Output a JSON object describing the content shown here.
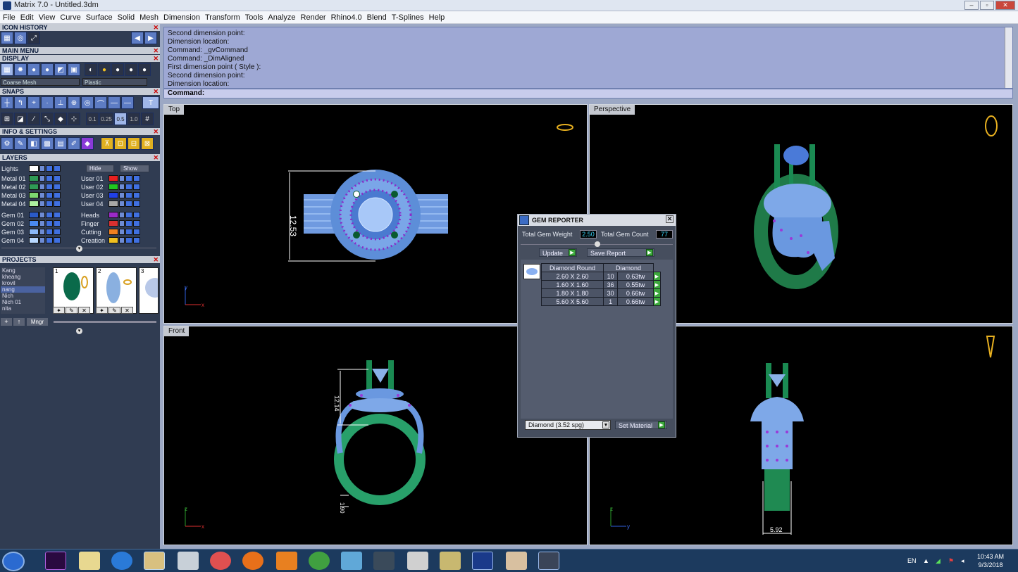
{
  "window": {
    "title": "Matrix 7.0 - Untitled.3dm",
    "min": "–",
    "max": "▫",
    "close": "✕"
  },
  "menu": [
    "File",
    "Edit",
    "View",
    "Curve",
    "Surface",
    "Solid",
    "Mesh",
    "Dimension",
    "Transform",
    "Tools",
    "Analyze",
    "Render",
    "Rhino4.0",
    "Blend",
    "T-Splines",
    "Help"
  ],
  "panel": {
    "icon_history": "ICON HISTORY",
    "main_menu": "MAIN MENU",
    "display": "DISPLAY",
    "display_dd1": "Coarse Mesh",
    "display_dd2": "Plastic",
    "snaps": "SNAPS",
    "snap_values": [
      "0.1",
      "0.25",
      "0.5",
      "1.0"
    ],
    "info": "INFO & SETTINGS",
    "layers": "LAYERS",
    "lights": "Lights",
    "hide": "Hide",
    "show": "Show",
    "layers_left": [
      {
        "name": "Metal 01",
        "color": "#2f9a55"
      },
      {
        "name": "Metal 02",
        "color": "#2f9a55"
      },
      {
        "name": "Metal 03",
        "color": "#7dd870"
      },
      {
        "name": "Metal 04",
        "color": "#aef0a0"
      },
      {
        "name": "Gem 01",
        "color": "#2a5ac8"
      },
      {
        "name": "Gem 02",
        "color": "#4a8af0"
      },
      {
        "name": "Gem 03",
        "color": "#8ab8f8"
      },
      {
        "name": "Gem 04",
        "color": "#b8d8ff"
      }
    ],
    "layers_right": [
      {
        "name": "User 01",
        "color": "#e82020"
      },
      {
        "name": "User 02",
        "color": "#20c820"
      },
      {
        "name": "User 03",
        "color": "#2040e8"
      },
      {
        "name": "User 04",
        "color": "#a8a8a8"
      },
      {
        "name": "Heads",
        "color": "#9a2ac8"
      },
      {
        "name": "Finger",
        "color": "#d83030"
      },
      {
        "name": "Cutting",
        "color": "#f08020"
      },
      {
        "name": "Creation",
        "color": "#f0c020"
      }
    ],
    "projects": "PROJECTS",
    "project_list": [
      "Kang",
      "kheang",
      "krovil",
      "nang",
      "Nich",
      "Nich 01",
      "nita"
    ],
    "thumbs": [
      "1",
      "2",
      "3"
    ],
    "mngr": "Mngr"
  },
  "command": {
    "history": [
      "Second dimension point:",
      "Dimension location:",
      "Command: _gvCommand",
      "Command: _DimAligned",
      "First dimension point ( Style ):",
      "Second dimension point:",
      "Dimension location:"
    ],
    "prompt": "Command:"
  },
  "viewports": {
    "top": {
      "label": "Top",
      "dim": "12.53",
      "axis_y": "y",
      "axis_x": "x"
    },
    "perspective": {
      "label": "Perspective"
    },
    "front": {
      "label": "Front",
      "dim1": "12.14",
      "dim2": "1.90",
      "axis_z": "z",
      "axis_x": "x"
    },
    "right": {
      "dim": "5.92",
      "axis_z": "z",
      "axis_y": "y"
    }
  },
  "gem_reporter": {
    "title": "GEM REPORTER",
    "weight_label": "Total Gem Weight",
    "weight": "2.50",
    "count_label": "Total Gem Count",
    "count": "77",
    "update": "Update",
    "save_report": "Save Report",
    "col_shape": "Diamond Round",
    "col_material": "Diamond",
    "rows": [
      {
        "size": "2.60 X 2.60",
        "count": "10",
        "tw": "0.63tw"
      },
      {
        "size": "1.60 X 1.60",
        "count": "36",
        "tw": "0.55tw"
      },
      {
        "size": "1.80 X 1.80",
        "count": "30",
        "tw": "0.66tw"
      },
      {
        "size": "5.60 X 5.60",
        "count": "1",
        "tw": "0.66tw"
      }
    ],
    "material": "Diamond      (3.52 spg)",
    "set_material": "Set Material"
  },
  "taskbar": {
    "lang": "EN",
    "time": "10:43 AM",
    "date": "9/3/2018"
  }
}
